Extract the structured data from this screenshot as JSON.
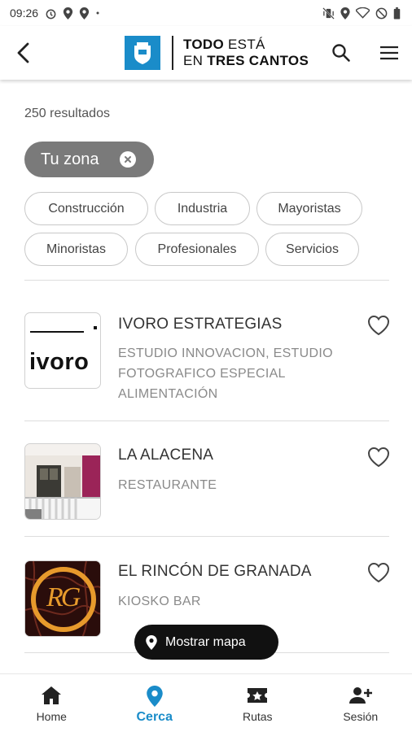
{
  "status_bar": {
    "time": "09:26"
  },
  "header": {
    "logo_line1_bold": "TODO",
    "logo_line1_light": " ESTÁ",
    "logo_line2_light": "EN ",
    "logo_line2_bold": "TRES CANTOS"
  },
  "results": {
    "count_text": "250 resultados"
  },
  "zone_filter": {
    "label": "Tu zona"
  },
  "category_chips": [
    "Construcción",
    "Industria",
    "Mayoristas",
    "Minoristas",
    "Profesionales",
    "Servicios"
  ],
  "listings": [
    {
      "title": "IVORO ESTRATEGIAS",
      "subtitle": "ESTUDIO INNOVACION, ESTUDIO FOTOGRAFICO ESPECIAL ALIMENTACIÓN",
      "logo_text": "ivoro"
    },
    {
      "title": "LA ALACENA",
      "subtitle": "RESTAURANTE"
    },
    {
      "title": "EL RINCÓN DE GRANADA",
      "subtitle": "KIOSKO BAR",
      "logo_text": "RG"
    }
  ],
  "map_button": {
    "label": "Mostrar mapa"
  },
  "bottom_nav": [
    {
      "label": "Home",
      "icon": "home-icon"
    },
    {
      "label": "Cerca",
      "icon": "location-pin-icon",
      "active": true
    },
    {
      "label": "Rutas",
      "icon": "ticket-star-icon"
    },
    {
      "label": "Sesión",
      "icon": "person-add-icon"
    }
  ],
  "colors": {
    "accent": "#1a8cc9",
    "chip_active": "#7a7a7a",
    "text_muted": "#8a8a8a"
  }
}
